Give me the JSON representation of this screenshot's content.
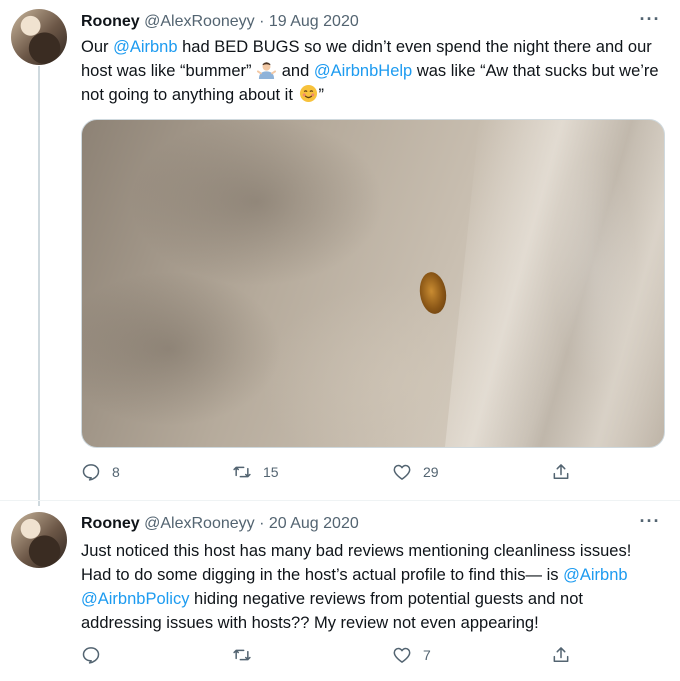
{
  "tweets": [
    {
      "name": "Rooney",
      "handle": "@AlexRooneyy",
      "separator": "·",
      "date": "19 Aug 2020",
      "text": {
        "p1": "Our ",
        "m1": "@Airbnb",
        "p2": " had BED BUGS so we didn’t even spend the night there and our host was like “bummer” ",
        "e1": "man-shrugging-emoji",
        "p3": " and ",
        "m2": "@AirbnbHelp",
        "p4": " was like “Aw that sucks but we’re not going to anything about it ",
        "e2": "smiling-face-emoji",
        "p5": "”"
      },
      "media": "photo of a bed bug on bed sheet",
      "actions": {
        "reply_count": "8",
        "retweet_count": "15",
        "like_count": "29",
        "share_count": ""
      }
    },
    {
      "name": "Rooney",
      "handle": "@AlexRooneyy",
      "separator": "·",
      "date": "20 Aug 2020",
      "text": {
        "p1": "Just noticed this host has many bad reviews mentioning cleanliness issues! Had to do some digging in the host’s actual profile to find this— is ",
        "m1": "@Airbnb",
        "p2": " ",
        "m2": "@AirbnbPolicy",
        "p3": " hiding negative reviews from potential guests and not addressing issues with hosts?? My review not even appearing!"
      },
      "actions": {
        "reply_count": "",
        "retweet_count": "",
        "like_count": "7",
        "share_count": ""
      }
    }
  ],
  "icons": {
    "more": "more-horizontal-icon",
    "reply": "reply-icon",
    "retweet": "retweet-icon",
    "like": "heart-icon",
    "share": "share-icon"
  },
  "colors": {
    "mention": "#1d9bf0",
    "secondary_text": "#536471",
    "thread_line": "#cfd9de"
  }
}
